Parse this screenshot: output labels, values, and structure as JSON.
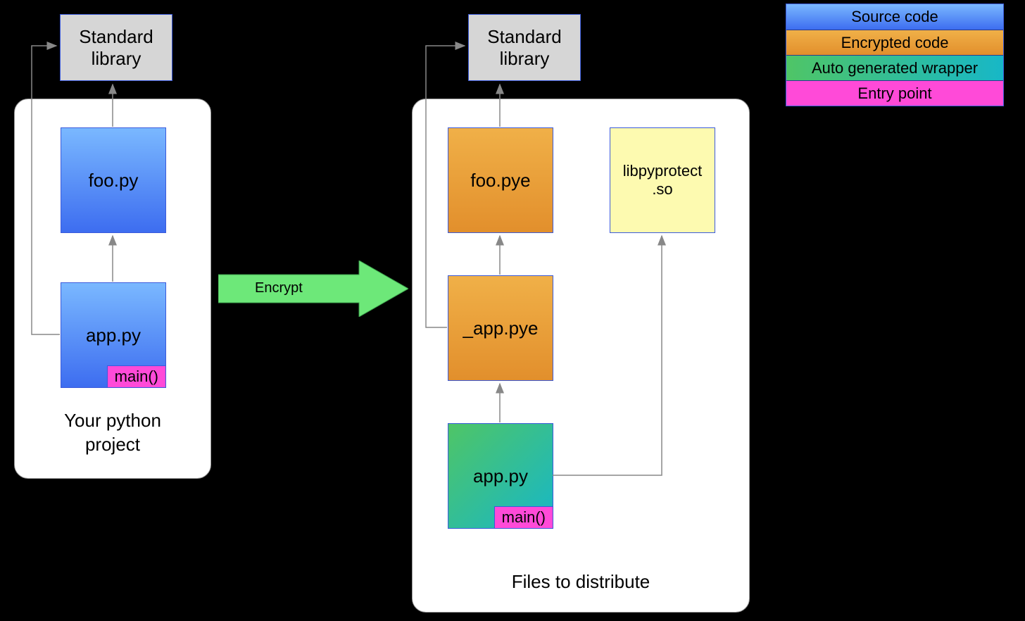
{
  "left": {
    "stdlib": "Standard library",
    "foo": "foo.py",
    "app": "app.py",
    "main": "main()",
    "caption": "Your python project"
  },
  "right": {
    "stdlib": "Standard library",
    "foo": "foo.pye",
    "app_enc": "_app.pye",
    "app_wrap": "app.py",
    "main": "main()",
    "lib": "libpyprotect.so",
    "caption": "Files to distribute"
  },
  "arrow": {
    "label": "Encrypt"
  },
  "legend": {
    "source": "Source code",
    "encrypted": "Encrypted code",
    "wrapper": "Auto generated wrapper",
    "entry": "Entry point"
  },
  "colors": {
    "source_grad": [
      "#7ab8ff",
      "#3d6df0"
    ],
    "encrypted_grad": [
      "#f0b048",
      "#e28f2c"
    ],
    "wrapper_grad": [
      "#4fc566",
      "#17b7c7"
    ],
    "entry": "#ff4ad8",
    "stdlib": "#d6d6d6",
    "lib": "#fdfab0",
    "border": "#3b5bdb",
    "arrow_fill": "#6de879",
    "connector": "#888888"
  }
}
